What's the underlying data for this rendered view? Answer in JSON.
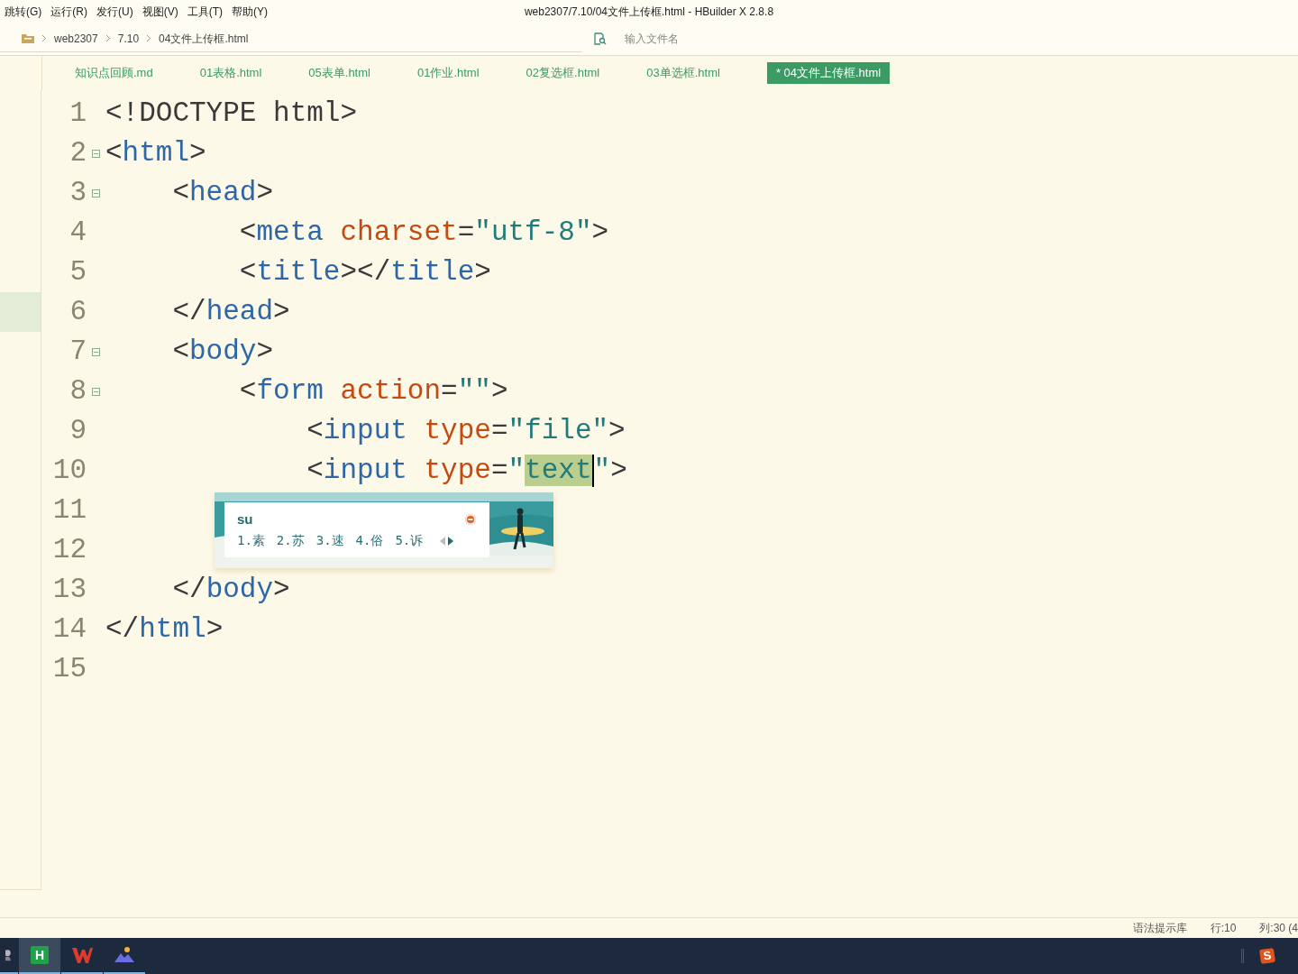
{
  "menu": [
    "跳转(G)",
    "运行(R)",
    "发行(U)",
    "视图(V)",
    "工具(T)",
    "帮助(Y)"
  ],
  "window": {
    "title": "web2307/7.10/04文件上传框.html - HBuilder X 2.8.8"
  },
  "breadcrumb": [
    "web2307",
    "7.10",
    "04文件上传框.html"
  ],
  "file_search": {
    "placeholder": "输入文件名"
  },
  "tabs": [
    {
      "label": "知识点回顾.md",
      "selected": false
    },
    {
      "label": "01表格.html",
      "selected": false
    },
    {
      "label": "05表单.html",
      "selected": false
    },
    {
      "label": "01作业.html",
      "selected": false
    },
    {
      "label": "02复选框.html",
      "selected": false
    },
    {
      "label": "03单选框.html",
      "selected": false
    },
    {
      "label": "* 04文件上传框.html",
      "selected": true
    }
  ],
  "editor": {
    "lines": [
      {
        "number": "1",
        "foldable": false,
        "marked": false,
        "tokens": [
          {
            "kind": "punct",
            "text": "<!DOCTYPE html>"
          }
        ]
      },
      {
        "number": "2",
        "foldable": true,
        "marked": false,
        "tokens": [
          {
            "kind": "punct",
            "text": "<"
          },
          {
            "kind": "tag",
            "text": "html"
          },
          {
            "kind": "punct",
            "text": ">"
          }
        ]
      },
      {
        "number": "3",
        "foldable": true,
        "marked": false,
        "tokens": [
          {
            "kind": "punct",
            "text": "    <"
          },
          {
            "kind": "tag",
            "text": "head"
          },
          {
            "kind": "punct",
            "text": ">"
          }
        ]
      },
      {
        "number": "4",
        "foldable": false,
        "marked": false,
        "tokens": [
          {
            "kind": "punct",
            "text": "        <"
          },
          {
            "kind": "tag",
            "text": "meta"
          },
          {
            "kind": "attr",
            "text": " charset"
          },
          {
            "kind": "punct",
            "text": "="
          },
          {
            "kind": "str",
            "text": "\"utf-8\""
          },
          {
            "kind": "punct",
            "text": ">"
          }
        ]
      },
      {
        "number": "5",
        "foldable": false,
        "marked": false,
        "tokens": [
          {
            "kind": "punct",
            "text": "        <"
          },
          {
            "kind": "tag",
            "text": "title"
          },
          {
            "kind": "punct",
            "text": "></"
          },
          {
            "kind": "tag",
            "text": "title"
          },
          {
            "kind": "punct",
            "text": ">"
          }
        ]
      },
      {
        "number": "6",
        "foldable": false,
        "marked": true,
        "tokens": [
          {
            "kind": "punct",
            "text": "    </"
          },
          {
            "kind": "tag",
            "text": "head"
          },
          {
            "kind": "punct",
            "text": ">"
          }
        ]
      },
      {
        "number": "7",
        "foldable": true,
        "marked": false,
        "tokens": [
          {
            "kind": "punct",
            "text": "    <"
          },
          {
            "kind": "tag",
            "text": "body"
          },
          {
            "kind": "punct",
            "text": ">"
          }
        ]
      },
      {
        "number": "8",
        "foldable": true,
        "marked": false,
        "tokens": [
          {
            "kind": "punct",
            "text": "        <"
          },
          {
            "kind": "tag",
            "text": "form"
          },
          {
            "kind": "attr",
            "text": " action"
          },
          {
            "kind": "punct",
            "text": "="
          },
          {
            "kind": "str",
            "text": "\"\""
          },
          {
            "kind": "punct",
            "text": ">"
          }
        ]
      },
      {
        "number": "9",
        "foldable": false,
        "marked": false,
        "tokens": [
          {
            "kind": "punct",
            "text": "            <"
          },
          {
            "kind": "tag",
            "text": "input"
          },
          {
            "kind": "attr",
            "text": " type"
          },
          {
            "kind": "punct",
            "text": "="
          },
          {
            "kind": "str",
            "text": "\"file\""
          },
          {
            "kind": "punct",
            "text": ">"
          }
        ]
      },
      {
        "number": "10",
        "foldable": false,
        "marked": false,
        "tokens": [
          {
            "kind": "punct",
            "text": "            <"
          },
          {
            "kind": "tag",
            "text": "input"
          },
          {
            "kind": "attr",
            "text": " type"
          },
          {
            "kind": "punct",
            "text": "="
          },
          {
            "kind": "str",
            "text": "\""
          },
          {
            "kind": "sel",
            "text": "text",
            "caret": true
          },
          {
            "kind": "str",
            "text": "\""
          },
          {
            "kind": "punct",
            "text": ">"
          }
        ]
      },
      {
        "number": "11",
        "foldable": false,
        "marked": false
      },
      {
        "number": "12",
        "foldable": false,
        "marked": false
      },
      {
        "number": "13",
        "foldable": false,
        "marked": false,
        "tokens": [
          {
            "kind": "punct",
            "text": "    </"
          },
          {
            "kind": "tag",
            "text": "body"
          },
          {
            "kind": "punct",
            "text": ">"
          }
        ]
      },
      {
        "number": "14",
        "foldable": false,
        "marked": false,
        "tokens": [
          {
            "kind": "punct",
            "text": "</"
          },
          {
            "kind": "tag",
            "text": "html"
          },
          {
            "kind": "punct",
            "text": ">"
          }
        ]
      },
      {
        "number": "15",
        "foldable": false,
        "marked": false
      }
    ]
  },
  "ime": {
    "input": "su",
    "candidates": [
      "1.素",
      "2.苏",
      "3.速",
      "4.俗",
      "5.诉"
    ]
  },
  "status_bar": [
    "语法提示库",
    "行:10",
    "列:30 (4"
  ],
  "taskbar": [
    {
      "kind": "avatar",
      "selected": false
    },
    {
      "kind": "hbuilder",
      "label": "H",
      "selected": true
    },
    {
      "kind": "wps",
      "selected": false
    },
    {
      "kind": "mountain",
      "selected": false
    }
  ],
  "tray": [
    {
      "kind": "sogou",
      "label": "S"
    }
  ]
}
